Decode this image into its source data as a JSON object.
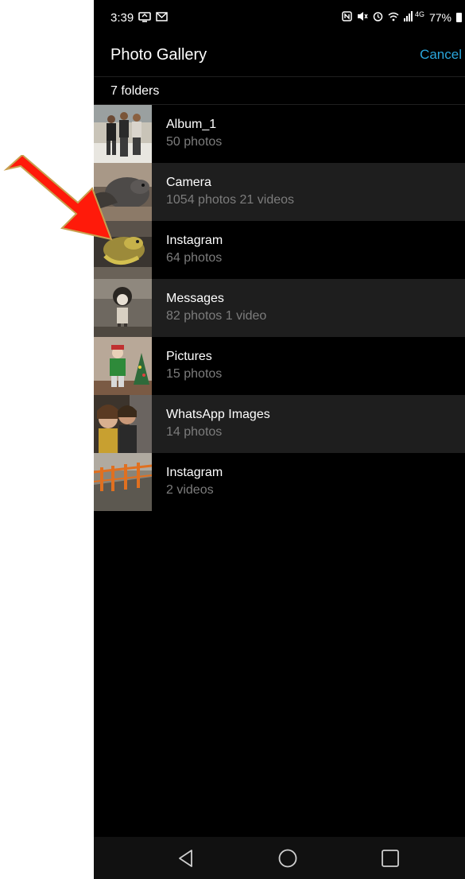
{
  "status_bar": {
    "time": "3:39",
    "left_icons": [
      "screen-share-icon",
      "gmail-icon"
    ],
    "right_icons": [
      "nfc-icon",
      "mute-icon",
      "alarm-icon",
      "wifi-icon",
      "signal-icon"
    ],
    "network": "4G",
    "battery": "77%"
  },
  "header": {
    "title": "Photo Gallery",
    "cancel_label": "Cancel"
  },
  "folder_count": "7 folders",
  "folders": [
    {
      "name": "Album_1",
      "meta": "50 photos"
    },
    {
      "name": "Camera",
      "meta": "1054 photos 21 videos"
    },
    {
      "name": "Instagram",
      "meta": "64 photos"
    },
    {
      "name": "Messages",
      "meta": "82 photos 1 video"
    },
    {
      "name": "Pictures",
      "meta": "15 photos"
    },
    {
      "name": "WhatsApp Images",
      "meta": "14 photos"
    },
    {
      "name": "Instagram",
      "meta": "2 videos"
    }
  ],
  "nav": {
    "icons": [
      "back-icon",
      "home-icon",
      "recents-icon"
    ]
  },
  "colors": {
    "accent": "#2aa6dc",
    "background": "#000000",
    "alt_row": "#1e1e1e",
    "secondary_text": "#7c7c7c",
    "annotation_arrow": "#ff0000"
  }
}
